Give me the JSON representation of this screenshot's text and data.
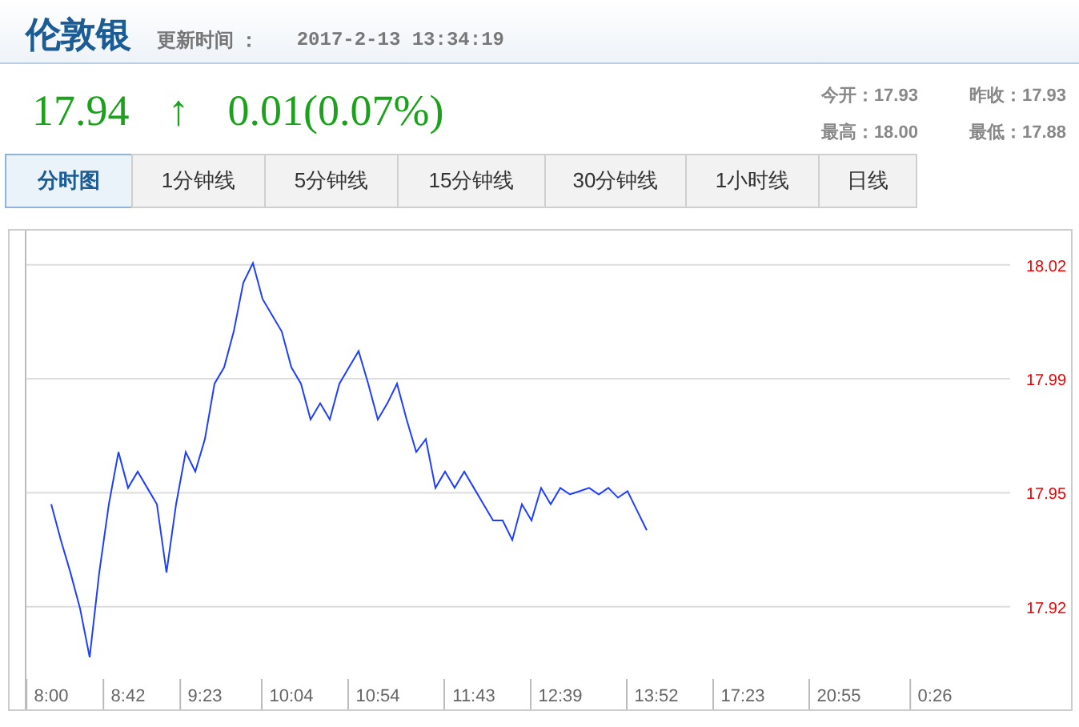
{
  "header": {
    "title": "伦敦银",
    "update_label": "更新时间 ：",
    "update_time": "2017-2-13 13:34:19"
  },
  "quote": {
    "price": "17.94",
    "arrow": "↑",
    "change": "0.01(0.07%)",
    "stats": [
      {
        "label": "今开：",
        "value": "17.93"
      },
      {
        "label": "昨收：",
        "value": "17.93"
      },
      {
        "label": "最高：",
        "value": "18.00"
      },
      {
        "label": "最低：",
        "value": "17.88"
      }
    ]
  },
  "tabs": [
    {
      "label": "分时图",
      "selected": true
    },
    {
      "label": "1分钟线",
      "selected": false
    },
    {
      "label": "5分钟线",
      "selected": false
    },
    {
      "label": "15分钟线",
      "selected": false
    },
    {
      "label": "30分钟线",
      "selected": false
    },
    {
      "label": "1小时线",
      "selected": false
    },
    {
      "label": "日线",
      "selected": false
    }
  ],
  "chart": {
    "chart_data": {
      "type": "line",
      "grid": true,
      "categories": [
        "8:00",
        null,
        null,
        null,
        null,
        null,
        null,
        null,
        "8:42",
        null,
        null,
        null,
        null,
        null,
        null,
        null,
        "9:23",
        null,
        null,
        null,
        null,
        null,
        null,
        null,
        null,
        "10:04",
        null,
        null,
        null,
        null,
        null,
        null,
        null,
        null,
        "10:54",
        null,
        null,
        null,
        null,
        null,
        null,
        null,
        null,
        null,
        "11:43",
        null,
        null,
        null,
        null,
        null,
        null,
        null,
        null,
        "12:39",
        null,
        null,
        null,
        null,
        null,
        null,
        null,
        null,
        null,
        "13:52",
        null,
        null,
        null,
        null,
        null,
        null,
        null,
        null,
        "17:23",
        null,
        null,
        null,
        null,
        null,
        null,
        null,
        null,
        null,
        "20:55",
        null,
        null,
        null,
        null,
        null,
        null,
        null,
        null,
        null,
        "0:26",
        null,
        null,
        null,
        null,
        null,
        null,
        null
      ],
      "series": [
        {
          "color": "#1f3fff",
          "values": [
            17.948,
            17.937,
            17.927,
            17.916,
            17.901,
            17.927,
            17.948,
            17.964,
            17.953,
            17.958,
            17.953,
            17.948,
            17.927,
            17.948,
            17.964,
            17.958,
            17.968,
            17.985,
            17.99,
            18.001,
            18.016,
            18.022,
            18.011,
            18.006,
            18.001,
            17.99,
            17.985,
            17.974,
            17.979,
            17.974,
            17.985,
            17.99,
            17.995,
            17.985,
            17.974,
            17.979,
            17.985,
            17.974,
            17.964,
            17.968,
            17.953,
            17.958,
            17.953,
            17.958,
            17.953,
            17.948,
            17.943,
            17.943,
            17.937,
            17.948,
            17.943,
            17.953,
            17.948,
            17.953,
            17.951,
            17.952,
            17.953,
            17.951,
            17.953,
            17.95,
            17.952,
            17.946,
            17.94,
            null,
            null,
            null,
            null,
            null,
            null,
            null,
            null,
            null,
            null,
            null,
            null,
            null,
            null,
            null,
            null,
            null,
            null,
            null,
            null,
            null,
            null,
            null,
            null,
            null,
            null,
            null,
            null,
            null,
            null,
            null,
            null,
            null,
            null,
            null,
            null,
            null
          ]
        }
      ],
      "ylim": [
        17.885,
        18.032
      ],
      "yticks": [
        {
          "value": 17.9165,
          "label": "17.92"
        },
        {
          "value": 17.9515,
          "label": "17.95"
        },
        {
          "value": 17.9865,
          "label": "17.99"
        },
        {
          "value": 18.0215,
          "label": "18.02"
        }
      ]
    }
  }
}
